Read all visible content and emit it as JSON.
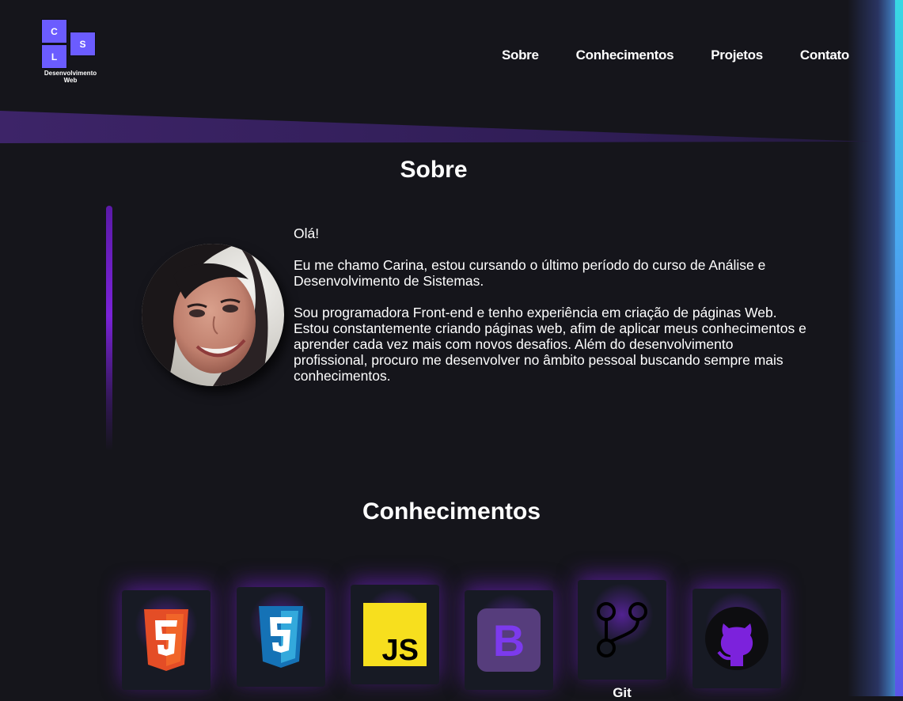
{
  "header": {
    "logo": {
      "letters": [
        "C",
        "S",
        "L"
      ],
      "caption_line1": "Desenvolvimento",
      "caption_line2": "Web"
    },
    "nav": [
      "Sobre",
      "Conhecimentos",
      "Projetos",
      "Contato"
    ]
  },
  "sobre": {
    "title": "Sobre",
    "greeting": "Olá!",
    "paragraph1": "Eu me chamo Carina, estou cursando o último período do curso de Análise e Desenvolvimento de Sistemas.",
    "paragraph2": "Sou programadora Front-end e tenho experiência em criação de páginas Web. Estou constantemente criando páginas web, afim de aplicar meus conhecimentos e aprender cada vez mais com novos desafios. Além do desenvolvimento profissional, procuro me desenvolver no âmbito pessoal buscando sempre mais conhecimentos."
  },
  "conhecimentos": {
    "title": "Conhecimentos",
    "skills": [
      {
        "icon": "html5-icon",
        "label": ""
      },
      {
        "icon": "css3-icon",
        "label": ""
      },
      {
        "icon": "javascript-icon",
        "label": ""
      },
      {
        "icon": "bootstrap-icon",
        "label": ""
      },
      {
        "icon": "git-icon",
        "label": "Git"
      },
      {
        "icon": "github-icon",
        "label": ""
      }
    ]
  },
  "colors": {
    "background": "#15151b",
    "accent_purple": "#6b5cff",
    "band_purple": "#3a1f66",
    "glow_purple": "#7c22dc"
  }
}
